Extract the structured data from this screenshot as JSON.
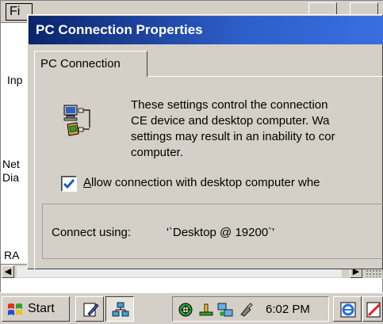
{
  "background_app": {
    "menu_file": "Fi",
    "labels": [
      "Inp",
      "Net",
      "Dia",
      "RA"
    ]
  },
  "dialog": {
    "title": "PC Connection Properties",
    "tabs": [
      {
        "label": "PC Connection",
        "selected": true
      }
    ],
    "description_lines": [
      "These settings control the connection",
      "CE device and desktop computer.  Wa",
      "settings may result in an inability to cor",
      "computer."
    ],
    "allow_connection": {
      "checked": true,
      "label_mnemonic": "A",
      "label_rest": "llow connection with desktop computer whe"
    },
    "connect_using_label": "Connect using:",
    "connect_using_value": "'`Desktop @ 19200`'"
  },
  "taskbar": {
    "start_label": "Start",
    "clock": "6:02 PM",
    "tray_icons": [
      "wireless-icon",
      "usb-icon",
      "network-icon",
      "connection-icon"
    ],
    "task_buttons": [
      "pen-icon",
      "network-app-icon"
    ],
    "end_buttons": [
      "ie-icon",
      "edit-icon"
    ]
  },
  "colors": {
    "title_bar_start": "#0a246a",
    "title_bar_end": "#3a6ee0",
    "face": "#d4d0c8",
    "check_mark": "#1060c0"
  }
}
